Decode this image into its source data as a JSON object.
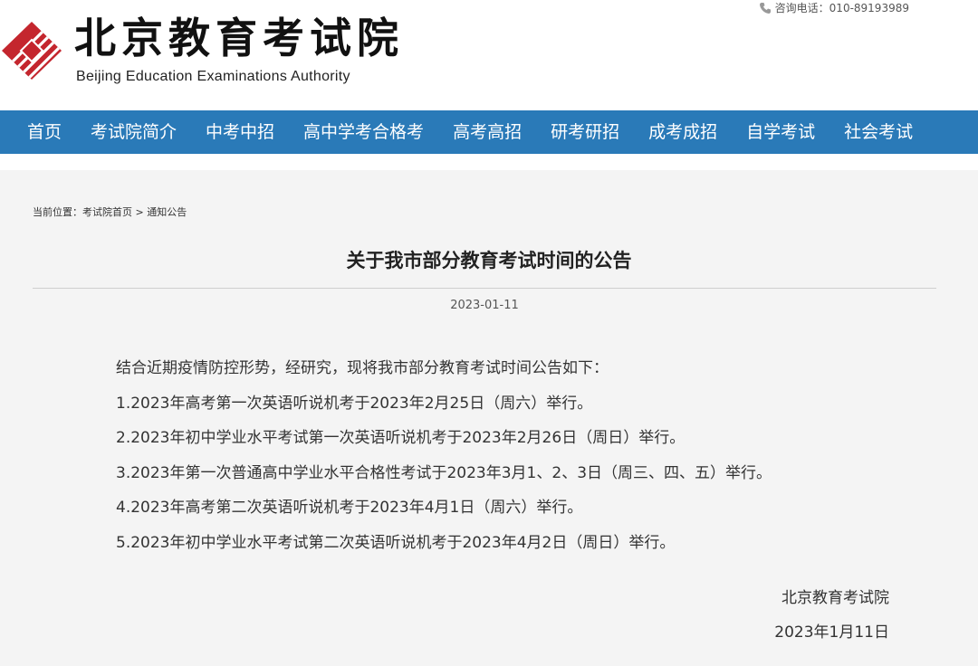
{
  "header": {
    "logo_title": "北京教育考试院",
    "logo_subtitle": "Beijing Education Examinations Authority",
    "hotline_label": "咨询电话：010-89193989",
    "logo_icon": "diamond-stripes-logo",
    "phone_icon": "phone-icon"
  },
  "nav": {
    "items": [
      {
        "label": "首页"
      },
      {
        "label": "考试院简介"
      },
      {
        "label": "中考中招"
      },
      {
        "label": "高中学考合格考"
      },
      {
        "label": "高考高招"
      },
      {
        "label": "研考研招"
      },
      {
        "label": "成考成招"
      },
      {
        "label": "自学考试"
      },
      {
        "label": "社会考试"
      }
    ]
  },
  "breadcrumb": {
    "prefix": "当前位置：",
    "home": "考试院首页",
    "separator": " > ",
    "current": "通知公告"
  },
  "article": {
    "title": "关于我市部分教育考试时间的公告",
    "date": "2023-01-11",
    "intro": "结合近期疫情防控形势，经研究，现将我市部分教育考试时间公告如下：",
    "items": [
      "1.2023年高考第一次英语听说机考于2023年2月25日（周六）举行。",
      "2.2023年初中学业水平考试第一次英语听说机考于2023年2月26日（周日）举行。",
      "3.2023年第一次普通高中学业水平合格性考试于2023年3月1、2、3日（周三、四、五）举行。",
      "4.2023年高考第二次英语听说机考于2023年4月1日（周六）举行。",
      "5.2023年初中学业水平考试第二次英语听说机考于2023年4月2日（周日）举行。"
    ],
    "signature_org": "北京教育考试院",
    "signature_date": "2023年1月11日"
  },
  "colors": {
    "nav_background": "#2a7ab8",
    "logo_red": "#c4262e",
    "content_background": "#f4f4f4"
  }
}
